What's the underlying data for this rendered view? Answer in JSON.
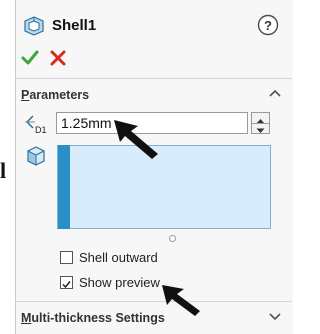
{
  "header": {
    "title": "Shell1",
    "help_icon": "question-circle-icon",
    "ok_icon": "green-check-icon",
    "cancel_icon": "red-x-icon"
  },
  "parameters": {
    "section_title_underlined": "P",
    "section_title_rest": "arameters",
    "thickness_icon_label": "D1",
    "thickness_value": "1.25mm",
    "faces_icon": "faces-to-remove-icon",
    "shell_outward_label": "Shell outward",
    "shell_outward_checked": false,
    "show_preview_label": "Show preview",
    "show_preview_checked": true
  },
  "multi_thickness": {
    "section_title_underlined": "M",
    "section_title_rest": "ulti-thickness Settings"
  },
  "left_edge_fragment": "l",
  "colors": {
    "accent_blue": "#2a8fc4",
    "list_fill": "#d9ecfb",
    "ok_green": "#3ea63e",
    "cancel_red": "#d52b1e"
  }
}
